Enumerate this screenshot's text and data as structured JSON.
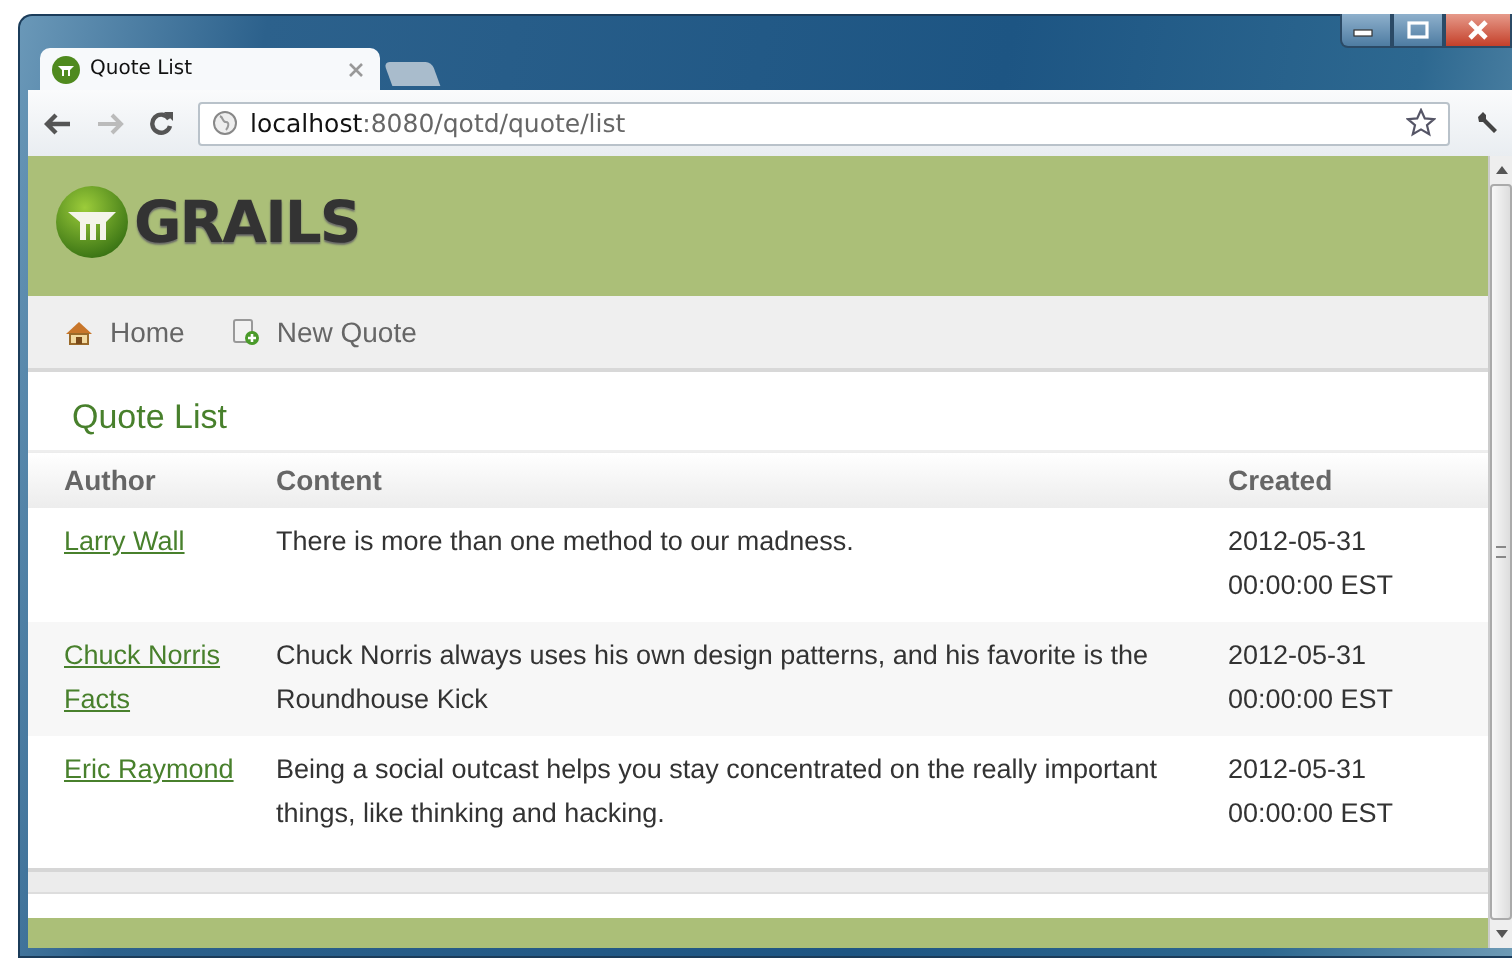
{
  "browser": {
    "tab": {
      "title": "Quote List"
    },
    "address": {
      "host": "localhost",
      "path": ":8080/qotd/quote/list"
    }
  },
  "app": {
    "logo": "GRAILS",
    "nav": [
      {
        "label": "Home",
        "kind": "home"
      },
      {
        "label": "New Quote",
        "kind": "create"
      }
    ],
    "heading": "Quote List",
    "table": {
      "columns": [
        "Author",
        "Content",
        "Created"
      ],
      "rows": [
        {
          "author": "Larry Wall",
          "content": "There is more than one method to our madness.",
          "created": "2012-05-31 00:00:00 EST"
        },
        {
          "author": "Chuck Norris Facts",
          "content": "Chuck Norris always uses his own design patterns, and his favorite is the Roundhouse Kick",
          "created": "2012-05-31 00:00:00 EST"
        },
        {
          "author": "Eric Raymond",
          "content": "Being a social outcast helps you stay concentrated on the really important things, like thinking and hacking.",
          "created": "2012-05-31 00:00:00 EST"
        }
      ]
    }
  }
}
